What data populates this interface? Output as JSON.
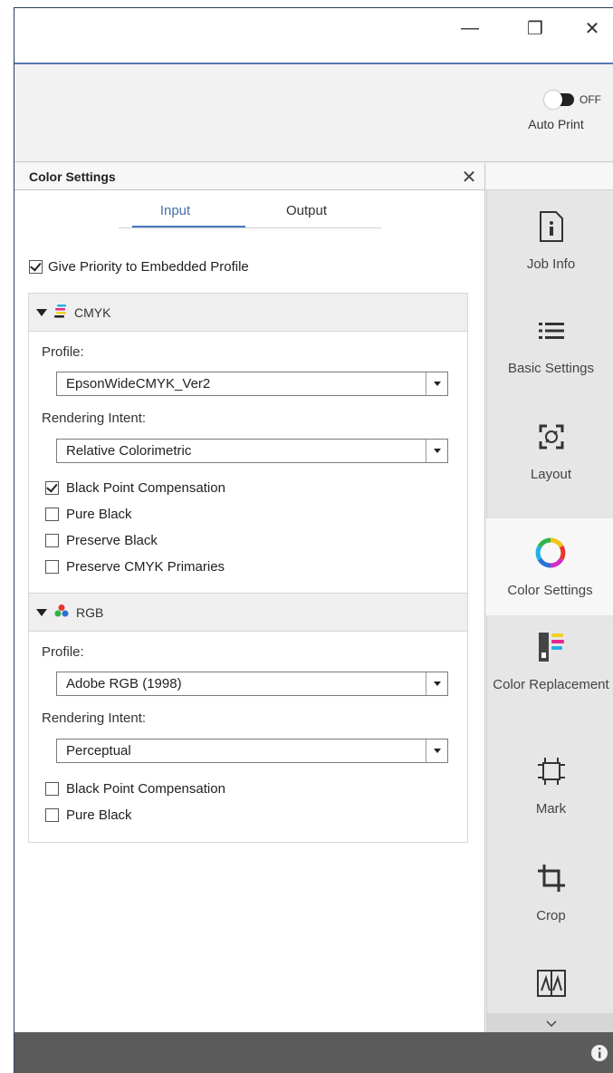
{
  "window": {
    "minimize_glyph": "—",
    "maximize_glyph": "❐",
    "close_glyph": "✕"
  },
  "header": {
    "toggle_state": "OFF",
    "auto_print_label": "Auto Print"
  },
  "panel": {
    "title": "Color Settings",
    "close_glyph": "✕",
    "tabs": [
      {
        "label": "Input",
        "selected": true
      },
      {
        "label": "Output",
        "selected": false
      }
    ],
    "priority_label": "Give Priority to Embedded Profile",
    "priority_checked": true,
    "cmyk": {
      "name": "CMYK",
      "profile_label": "Profile:",
      "profile_value": "EpsonWideCMYK_Ver2",
      "intent_label": "Rendering Intent:",
      "intent_value": "Relative Colorimetric",
      "options": [
        {
          "label": "Black Point Compensation",
          "checked": true
        },
        {
          "label": "Pure Black",
          "checked": false
        },
        {
          "label": "Preserve Black",
          "checked": false
        },
        {
          "label": "Preserve CMYK Primaries",
          "checked": false
        }
      ]
    },
    "rgb": {
      "name": "RGB",
      "profile_label": "Profile:",
      "profile_value": "Adobe RGB (1998)",
      "intent_label": "Rendering Intent:",
      "intent_value": "Perceptual",
      "options": [
        {
          "label": "Black Point Compensation",
          "checked": false
        },
        {
          "label": "Pure Black",
          "checked": false
        }
      ]
    }
  },
  "nav": {
    "items": [
      {
        "label": "Job Info",
        "icon": "job-info-icon"
      },
      {
        "label": "Basic Settings",
        "icon": "list-icon"
      },
      {
        "label": "Layout",
        "icon": "layout-icon"
      },
      {
        "label": "Color Settings",
        "icon": "color-wheel-icon",
        "active": true
      },
      {
        "label": "Color Replacement",
        "icon": "color-replacement-icon"
      },
      {
        "label": "Mark",
        "icon": "mark-icon"
      },
      {
        "label": "Crop",
        "icon": "crop-icon"
      },
      {
        "label": "",
        "icon": "panel-more-icon"
      }
    ]
  },
  "colors": {
    "accent": "#4a78c2",
    "bottom_bar": "#5c5c5c"
  }
}
